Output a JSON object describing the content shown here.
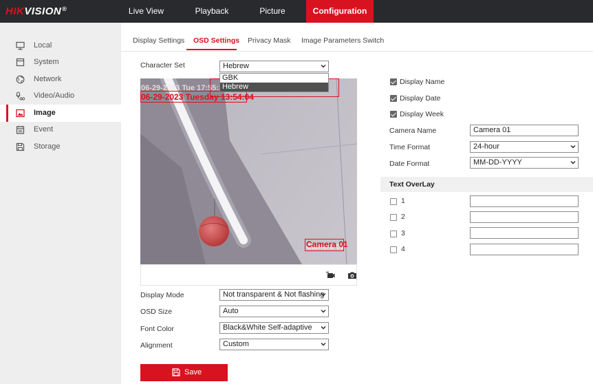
{
  "brand": {
    "name_red": "HIK",
    "name_white": "VISION",
    "reg": "®"
  },
  "topnav": [
    {
      "label": "Live View"
    },
    {
      "label": "Playback"
    },
    {
      "label": "Picture"
    },
    {
      "label": "Configuration"
    }
  ],
  "sidebar": {
    "items": [
      {
        "label": "Local",
        "icon": "monitor-icon"
      },
      {
        "label": "System",
        "icon": "window-icon"
      },
      {
        "label": "Network",
        "icon": "globe-icon"
      },
      {
        "label": "Video/Audio",
        "icon": "audio-video-icon"
      },
      {
        "label": "Image",
        "icon": "image-icon"
      },
      {
        "label": "Event",
        "icon": "calendar-icon"
      },
      {
        "label": "Storage",
        "icon": "storage-icon"
      }
    ],
    "active": "Image"
  },
  "tabs": [
    {
      "label": "Display Settings"
    },
    {
      "label": "OSD Settings"
    },
    {
      "label": "Privacy Mask"
    },
    {
      "label": "Image Parameters Switch"
    }
  ],
  "character_set": {
    "label": "Character Set",
    "value": "Hebrew",
    "options": [
      "GBK",
      "Hebrew"
    ]
  },
  "video": {
    "osd_date": "06-29-2023 Tuesday 13:54:04",
    "osd_ghost": "06-29-2023 Tue 17:55:26",
    "osd_camera": "Camera 01",
    "osd_camera_ghost": "Camera 01"
  },
  "left_form": {
    "display_mode": {
      "label": "Display Mode",
      "value": "Not transparent & Not flashing"
    },
    "osd_size": {
      "label": "OSD Size",
      "value": "Auto"
    },
    "font_color": {
      "label": "Font Color",
      "value": "Black&White Self-adaptive"
    },
    "alignment": {
      "label": "Alignment",
      "value": "Custom"
    }
  },
  "right_form": {
    "display_name": {
      "label": "Display Name",
      "checked": true
    },
    "display_date": {
      "label": "Display Date",
      "checked": true
    },
    "display_week": {
      "label": "Display Week",
      "checked": true
    },
    "camera_name": {
      "label": "Camera Name",
      "value": "Camera 01"
    },
    "time_format": {
      "label": "Time Format",
      "value": "24-hour"
    },
    "date_format": {
      "label": "Date Format",
      "value": "MM-DD-YYYY"
    }
  },
  "text_overlay": {
    "title": "Text OverLay",
    "rows": [
      {
        "label": "1",
        "value": ""
      },
      {
        "label": "2",
        "value": ""
      },
      {
        "label": "3",
        "value": ""
      },
      {
        "label": "4",
        "value": ""
      }
    ]
  },
  "save": {
    "label": "Save"
  },
  "colors": {
    "accent": "#d9121f",
    "topbar": "#292a2d",
    "sidebar": "#eeeeee"
  }
}
